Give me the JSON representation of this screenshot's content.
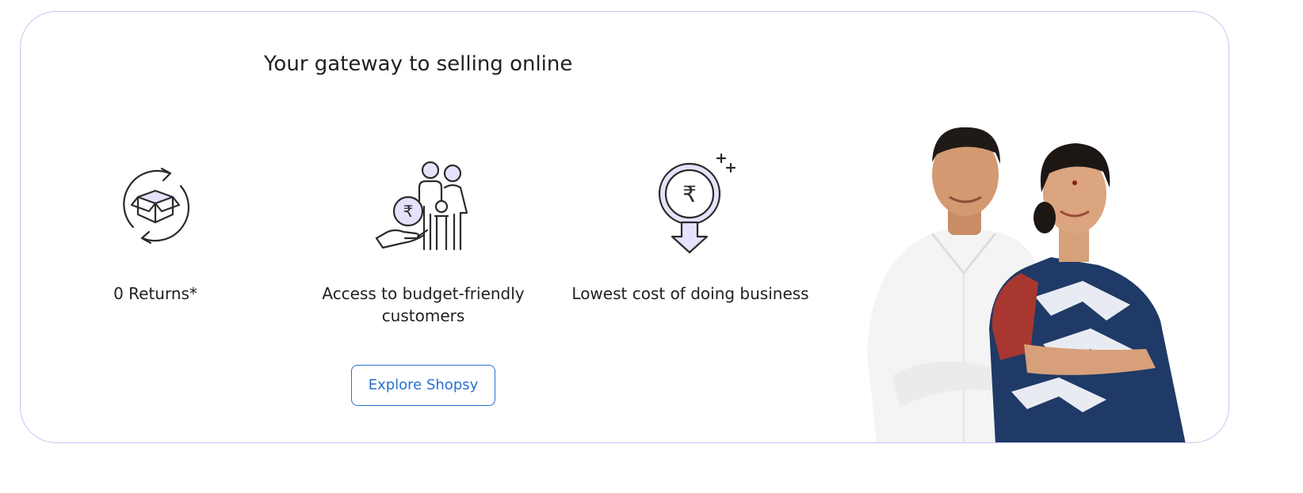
{
  "banner": {
    "heading": "Your gateway to selling online",
    "features": [
      {
        "icon": "box-returns-icon",
        "label": "0 Returns*"
      },
      {
        "icon": "family-rupee-icon",
        "label": "Access to budget-friendly customers"
      },
      {
        "icon": "rupee-down-icon",
        "label": "Lowest cost of doing business"
      }
    ],
    "cta_label": "Explore Shopsy",
    "illustration": "seller-couple-photo"
  },
  "colors": {
    "card_border": "#c9c3f2",
    "icon_accent": "#e6e2fb",
    "icon_stroke": "#2b2b2b",
    "cta_blue": "#2a6fd1",
    "text": "#212121"
  }
}
